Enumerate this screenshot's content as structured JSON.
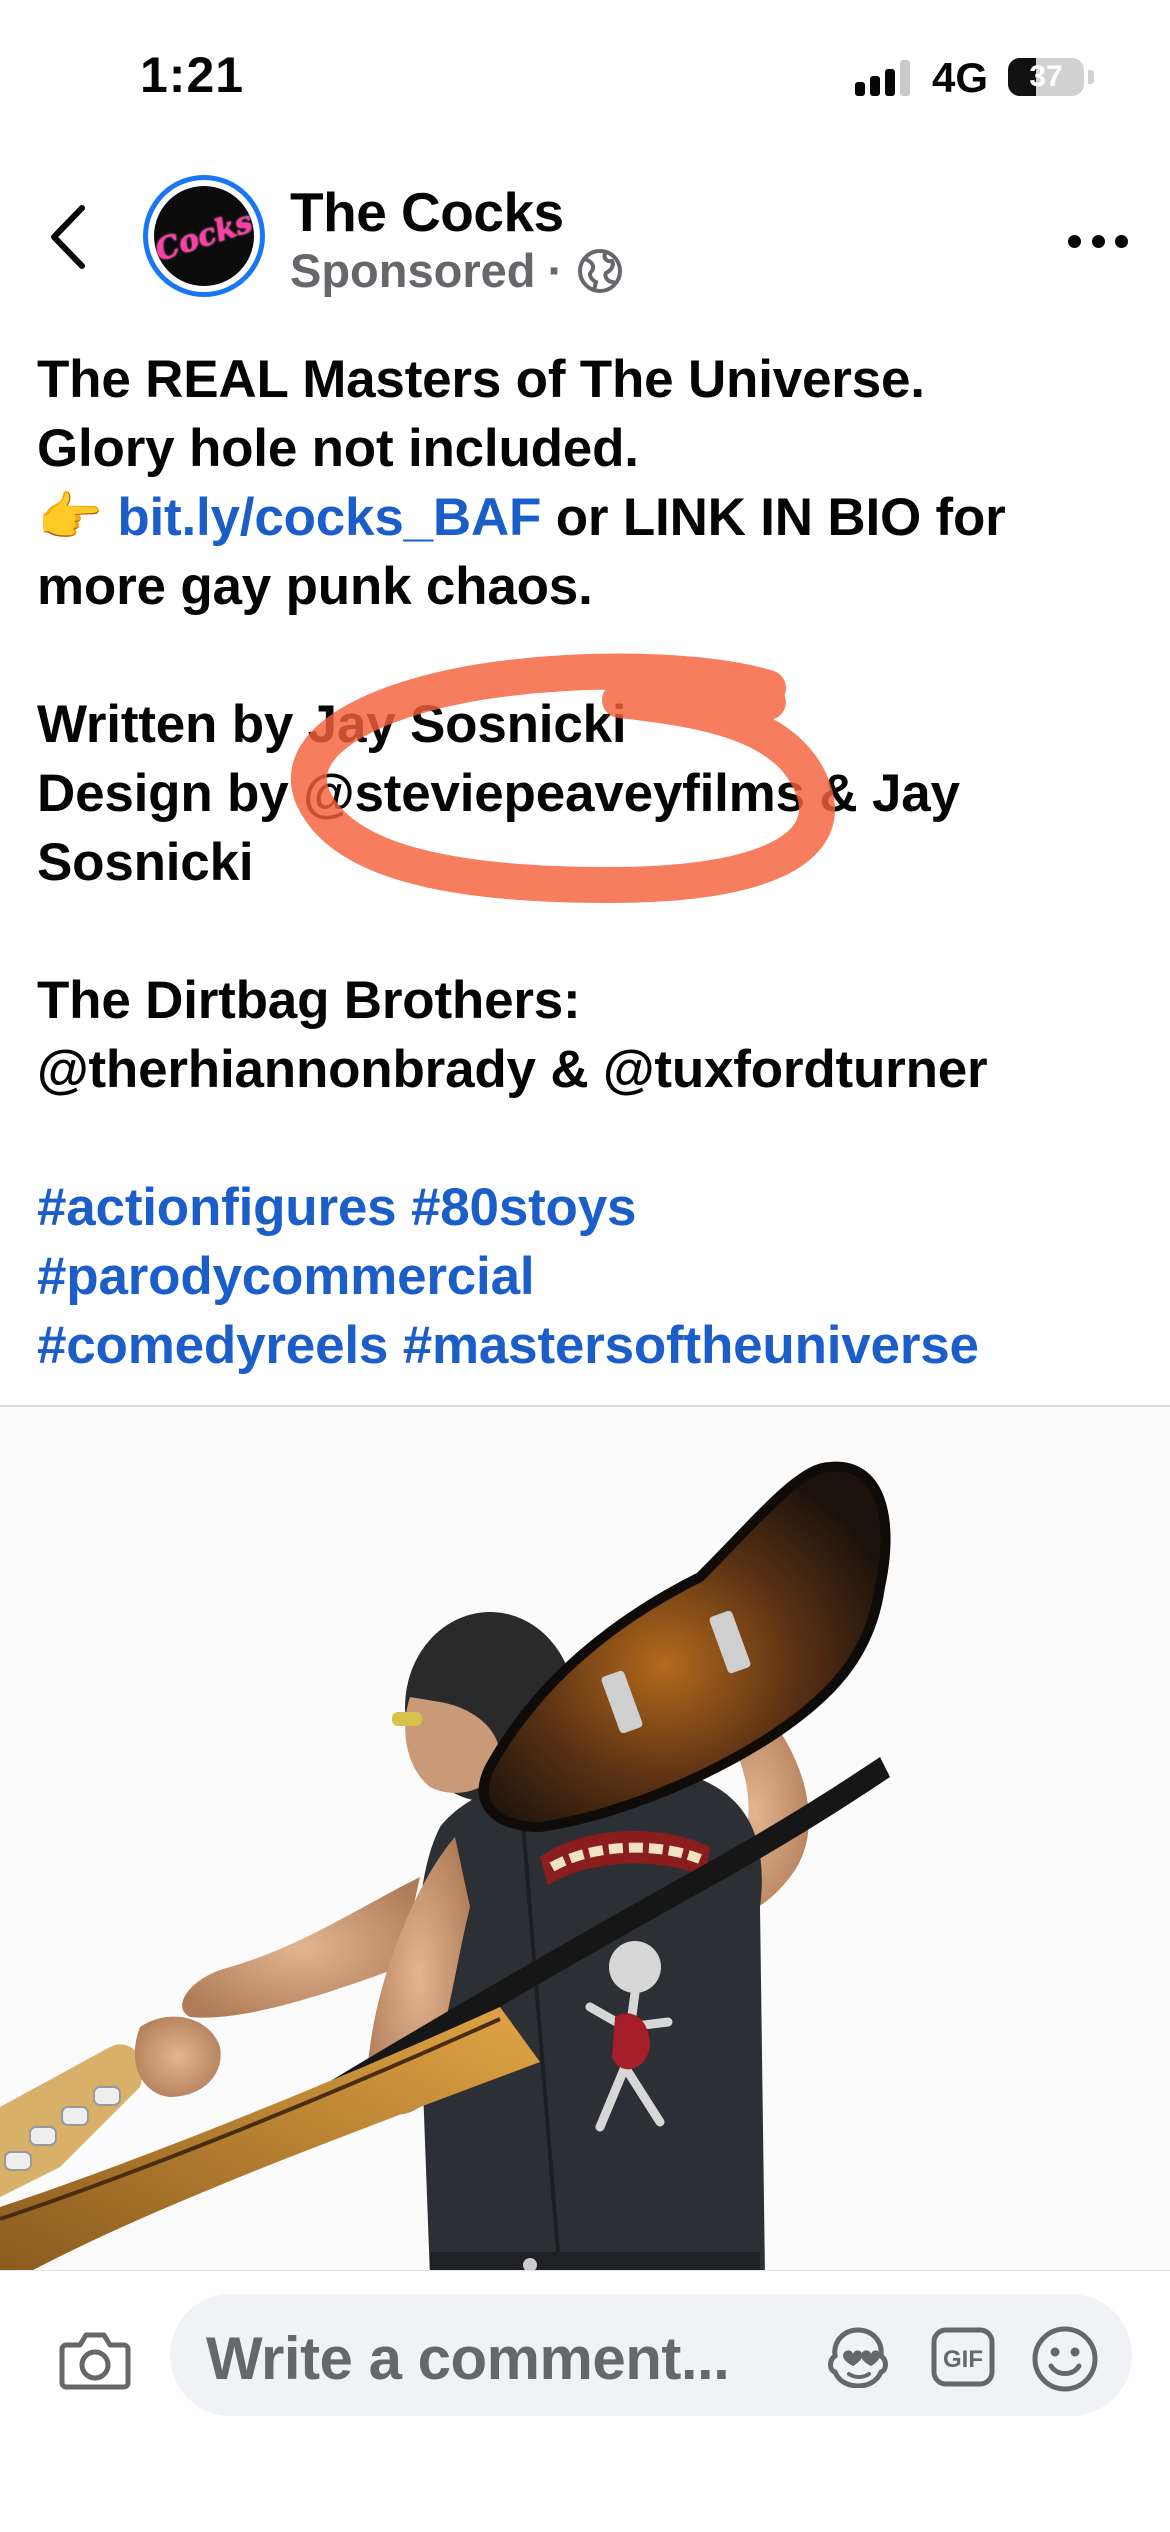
{
  "status_bar": {
    "time": "1:21",
    "network": "4G",
    "battery": "37",
    "battery_level": 0.37
  },
  "post": {
    "page_name": "The Cocks",
    "sponsored_label": "Sponsored",
    "meta_separator": "·",
    "avatar_logo_text": "Cocks",
    "caption": {
      "line1": "The REAL Masters of The Universe.",
      "line2": "Glory hole not included.",
      "line3_emoji": "👉",
      "line3_link": "bit.ly/cocks_BAF",
      "line3_rest": " or LINK IN BIO for",
      "line4": "more gay punk chaos.",
      "written_by": "Written by Jay Sosnicki",
      "design_by_line1": "Design by @steviepeaveyfilms & Jay",
      "design_by_line2": "Sosnicki",
      "dirtbag_title": "The Dirtbag Brothers:",
      "dirtbag_names": "@therhiannonbrady & @tuxfordturner",
      "hashtags": [
        [
          "#actionfigures",
          "#80stoys"
        ],
        [
          "#parodycommercial"
        ],
        [
          "#comedyreels",
          "#mastersoftheuniverse"
        ]
      ]
    },
    "annotation_color": "#f4623a"
  },
  "comment_bar": {
    "placeholder": "Write a comment...",
    "gif_label": "GIF"
  },
  "colors": {
    "link": "#1b5dc9",
    "secondary_text": "#65676b",
    "accent": "#1877f2"
  }
}
